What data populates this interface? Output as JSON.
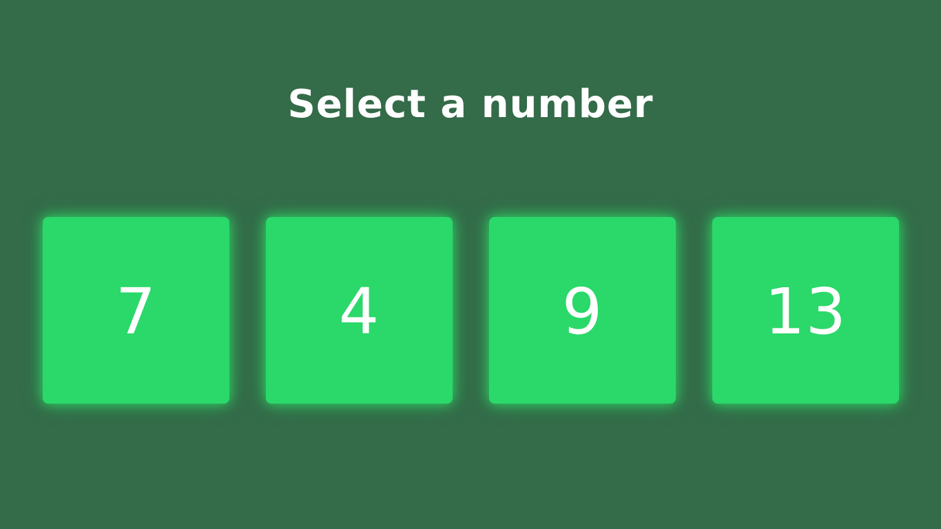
{
  "screen": {
    "title": "Select a number",
    "options": [
      {
        "label": "7"
      },
      {
        "label": "4"
      },
      {
        "label": "9"
      },
      {
        "label": "13"
      }
    ]
  },
  "colors": {
    "background": "#346b49",
    "card": "#2bd86a",
    "card_glow": "#2ce567",
    "text": "#ffffff"
  }
}
